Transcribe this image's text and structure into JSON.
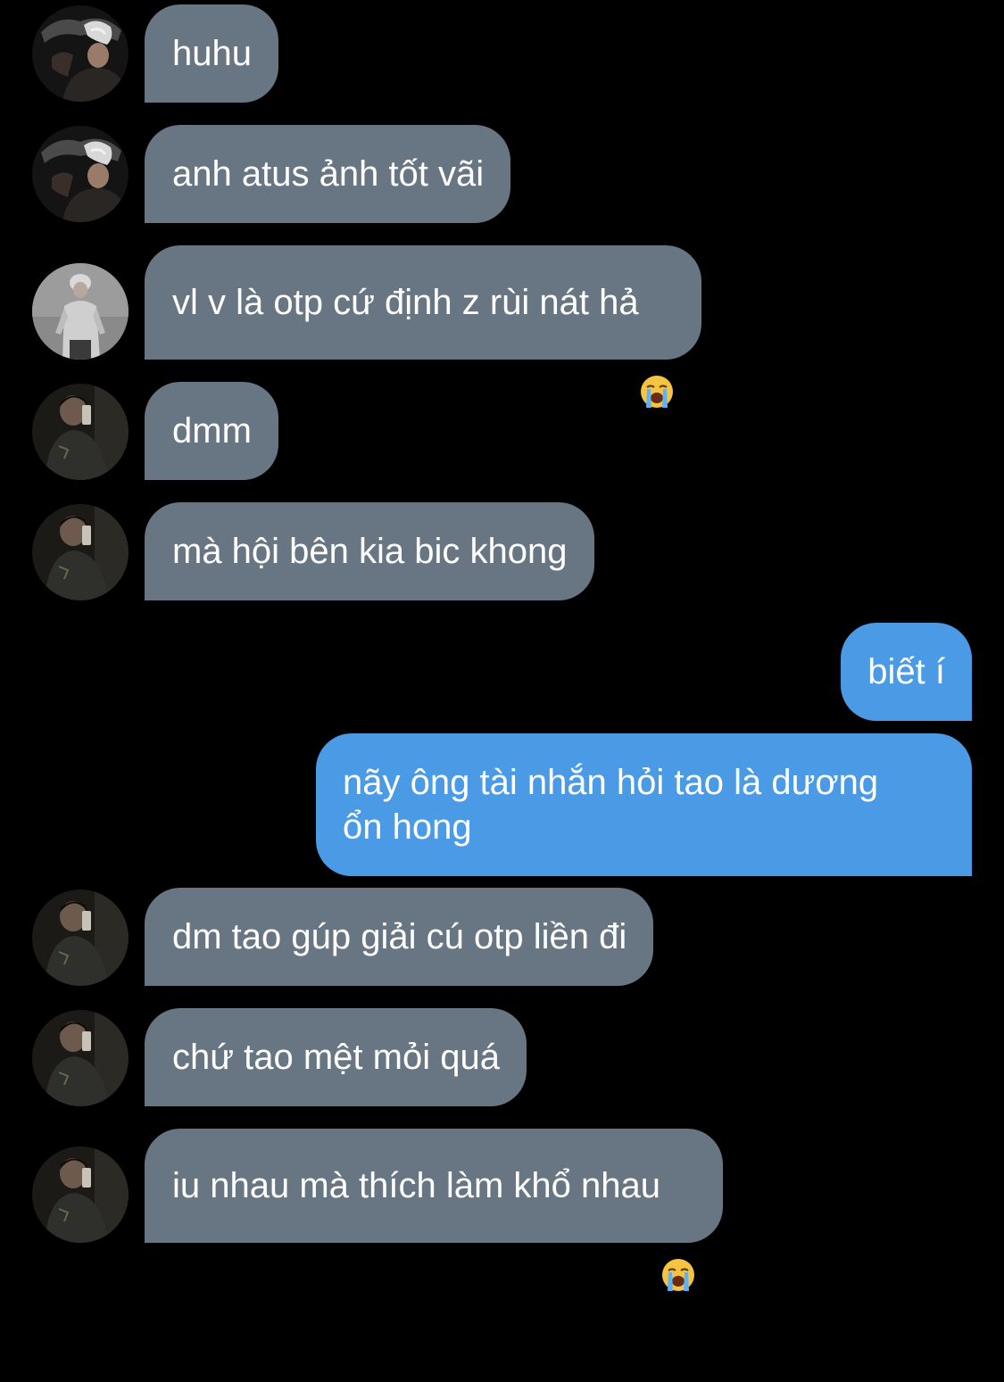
{
  "messages": [
    {
      "side": "in",
      "avatar": "avatar-blond",
      "text": "huhu",
      "emoji": ""
    },
    {
      "side": "in",
      "avatar": "avatar-blond",
      "text": "anh atus ảnh tốt vãi",
      "emoji": ""
    },
    {
      "side": "in",
      "avatar": "avatar-hoodie",
      "text": "vl v là otp cứ định z rùi nát hả",
      "emoji": "loudly-crying-face-emoji"
    },
    {
      "side": "in",
      "avatar": "avatar-mirror-selfie",
      "text": "dmm",
      "emoji": ""
    },
    {
      "side": "in",
      "avatar": "avatar-mirror-selfie",
      "text": "mà hội bên kia bic khong",
      "emoji": ""
    },
    {
      "side": "out",
      "avatar": "",
      "text": "biết í",
      "emoji": ""
    },
    {
      "side": "out",
      "avatar": "",
      "text": "nãy ông tài nhắn hỏi tao là dương\nổn hong",
      "emoji": ""
    },
    {
      "side": "in",
      "avatar": "avatar-mirror-selfie",
      "text": "dm tao gúp giải cú otp liền đi",
      "emoji": ""
    },
    {
      "side": "in",
      "avatar": "avatar-mirror-selfie",
      "text": "chứ tao mệt mỏi quá",
      "emoji": ""
    },
    {
      "side": "in",
      "avatar": "avatar-mirror-selfie",
      "text": "iu nhau mà thích làm khổ nhau",
      "emoji": "loudly-crying-face-emoji"
    }
  ],
  "colors": {
    "background": "#000000",
    "incoming_bubble": "#687582",
    "outgoing_bubble": "#4a9ae6",
    "text": "#ffffff"
  }
}
